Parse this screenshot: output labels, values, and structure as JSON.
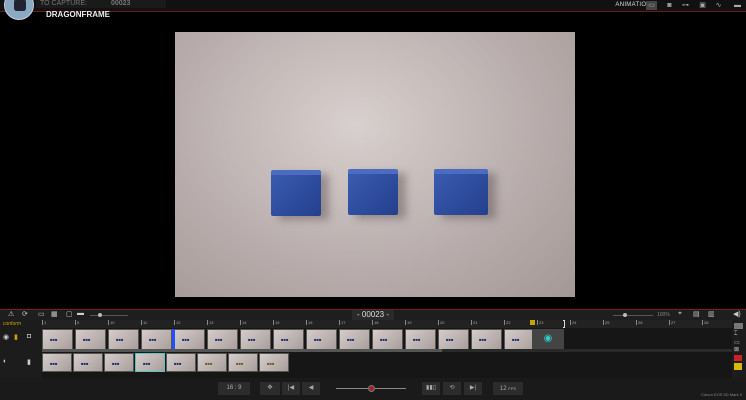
{
  "header": {
    "capture_label": "TO CAPTURE:",
    "capture_value": "00023",
    "title": "DRAGONFRAME",
    "mode": "ANIMATION",
    "icons": [
      "viewer-icon",
      "camera-icon",
      "timeline-icon",
      "settings-icon",
      "graph-icon",
      "window-icon"
    ]
  },
  "toolbar": {
    "frame_number": "- 00023 -",
    "zoom": "100%"
  },
  "timeline": {
    "track_label": "conform",
    "ticks": [
      "1",
      "9",
      "10",
      "11",
      "12",
      "13",
      "14",
      "15",
      "16",
      "17",
      "18",
      "19",
      "20",
      "21",
      "22",
      "23",
      "24",
      "25",
      "26",
      "27",
      "28"
    ],
    "take_count": 15,
    "row2_count": 8,
    "row2_selected": 3,
    "row2_yellow": [
      5,
      6,
      7
    ]
  },
  "bottom": {
    "aspect": "16 : 9",
    "fps_value": "12",
    "fps_unit": "FPS",
    "camera": "Canon EOS 5D Mark II"
  },
  "colors": {
    "accent_red": "#a22222",
    "highlight": "#4fc8c0",
    "conform": "#c9a200"
  }
}
